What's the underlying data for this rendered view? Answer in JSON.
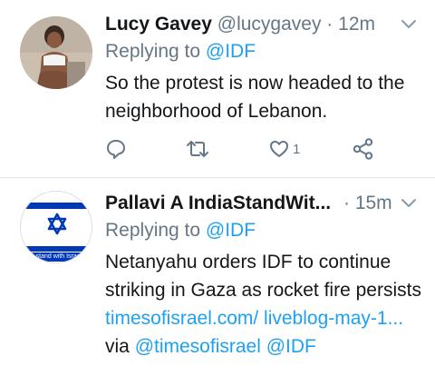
{
  "tweets": [
    {
      "display_name": "Lucy Gavey",
      "handle": "@lucygavey",
      "separator": "·",
      "time": "12m",
      "reply_prefix": "Replying to",
      "reply_to": "@IDF",
      "text": "So the protest is now headed to the neighborhood of Lebanon.",
      "like_count": "1"
    },
    {
      "display_name": "Pallavi A IndiaStandWit...",
      "separator": "·",
      "time": "15m",
      "reply_prefix": "Replying to",
      "reply_to": "@IDF",
      "text_part1": "Netanyahu orders IDF to continue striking in Gaza as rocket fire persists ",
      "link_text": "timesofisrael.com/ liveblog-may-1...",
      "text_part2": " via ",
      "mention_1": "@timesofisrael",
      "mention_2": "@IDF",
      "avatar_caption": "I stand with Israel"
    }
  ],
  "colors": {
    "accent": "#1da1f2",
    "secondary_text": "#657786",
    "primary_text": "#14171a",
    "israel_blue": "#0038b8"
  },
  "icons": [
    "reply-icon",
    "retweet-icon",
    "like-icon",
    "share-icon",
    "chevron-down-icon",
    "star-of-david-icon"
  ]
}
